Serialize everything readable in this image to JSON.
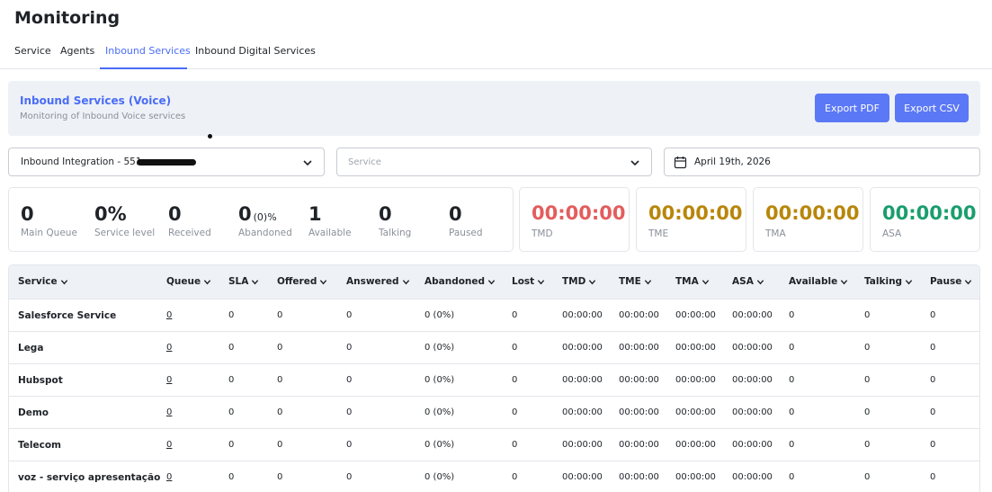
{
  "page": {
    "title": "Monitoring"
  },
  "tabs": [
    {
      "label": "Service",
      "active": false
    },
    {
      "label": "Agents",
      "active": false
    },
    {
      "label": "Inbound Services",
      "active": true
    },
    {
      "label": "Inbound Digital Services",
      "active": false
    }
  ],
  "banner": {
    "title": "Inbound Services (Voice)",
    "subtitle": "Monitoring of Inbound Voice services",
    "export_pdf": "Export PDF",
    "export_csv": "Export CSV"
  },
  "filters": {
    "integration": "Inbound Integration - 551",
    "service_placeholder": "Service",
    "date": "April 19th, 2026"
  },
  "metrics": [
    {
      "value": "0",
      "extra": "",
      "label": "Main Queue"
    },
    {
      "value": "0%",
      "extra": "",
      "label": "Service level"
    },
    {
      "value": "0",
      "extra": "",
      "label": "Received"
    },
    {
      "value": "0",
      "extra": "(0)%",
      "label": "Abandoned"
    },
    {
      "value": "1",
      "extra": "",
      "label": "Available"
    },
    {
      "value": "0",
      "extra": "",
      "label": "Talking"
    },
    {
      "value": "0",
      "extra": "",
      "label": "Paused"
    }
  ],
  "time_cards": [
    {
      "value": "00:00:00",
      "label": "TMD",
      "color": "#e35d5d"
    },
    {
      "value": "00:00:00",
      "label": "TME",
      "color": "#b8860b"
    },
    {
      "value": "00:00:00",
      "label": "TMA",
      "color": "#b8860b"
    },
    {
      "value": "00:00:00",
      "label": "ASA",
      "color": "#1a9e6e"
    }
  ],
  "table": {
    "columns": [
      "Service",
      "Queue",
      "SLA",
      "Offered",
      "Answered",
      "Abandoned",
      "Lost",
      "TMD",
      "TME",
      "TMA",
      "ASA",
      "Available",
      "Talking",
      "Pause"
    ],
    "rows": [
      [
        "Salesforce Service",
        "0",
        "0",
        "0",
        "0",
        "0 (0%)",
        "0",
        "00:00:00",
        "00:00:00",
        "00:00:00",
        "00:00:00",
        "0",
        "0",
        "0"
      ],
      [
        "Lega",
        "0",
        "0",
        "0",
        "0",
        "0 (0%)",
        "0",
        "00:00:00",
        "00:00:00",
        "00:00:00",
        "00:00:00",
        "0",
        "0",
        "0"
      ],
      [
        "Hubspot",
        "0",
        "0",
        "0",
        "0",
        "0 (0%)",
        "0",
        "00:00:00",
        "00:00:00",
        "00:00:00",
        "00:00:00",
        "0",
        "0",
        "0"
      ],
      [
        "Demo",
        "0",
        "0",
        "0",
        "0",
        "0 (0%)",
        "0",
        "00:00:00",
        "00:00:00",
        "00:00:00",
        "00:00:00",
        "0",
        "0",
        "0"
      ],
      [
        "Telecom",
        "0",
        "0",
        "0",
        "0",
        "0 (0%)",
        "0",
        "00:00:00",
        "00:00:00",
        "00:00:00",
        "00:00:00",
        "0",
        "0",
        "0"
      ],
      [
        "voz - serviço apresentação",
        "0",
        "0",
        "0",
        "0",
        "0 (0%)",
        "0",
        "00:00:00",
        "00:00:00",
        "00:00:00",
        "00:00:00",
        "0",
        "0",
        "0"
      ]
    ]
  }
}
